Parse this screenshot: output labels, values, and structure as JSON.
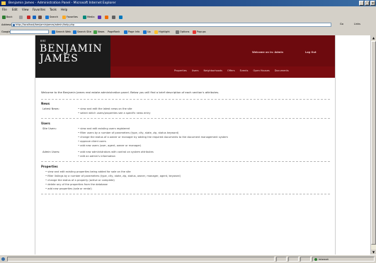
{
  "window": {
    "title": "Benjamin James - Administration Panel - Microsoft Internet Explorer",
    "controls": [
      "_",
      "□",
      "×"
    ]
  },
  "menubar": [
    "File",
    "Edit",
    "View",
    "Favorites",
    "Tools",
    "Help"
  ],
  "toolbar": {
    "back": "Back",
    "forward": "",
    "stop": "",
    "refresh": "",
    "home": "",
    "search": "Search",
    "favorites": "Favorites",
    "media": "Media",
    "history": "",
    "mail": "",
    "print": "",
    "edit": ""
  },
  "addressbar": {
    "label": "Address",
    "url": "http://localhost/benjaminjames/admin/help.php",
    "go": "Go",
    "links": "Links"
  },
  "googlebar": {
    "label": "Google",
    "search_web": "Search Web",
    "search_site": "Search Site",
    "news": "News",
    "pagerank": "PageRank",
    "page_info": "Page Info",
    "up": "Up",
    "highlight": "Highlight",
    "options": "Options",
    "popups": "Popups"
  },
  "site": {
    "logo_small": "BRE",
    "logo_line1": "BENJAMIN",
    "logo_line2": "JAMES",
    "welcome_user": "Welcome on in: Admin",
    "logout": "Log Out",
    "nav": [
      "Properties",
      "Users",
      "Neighborhoods",
      "Offers",
      "Events",
      "Open Houses",
      "Documents"
    ]
  },
  "content": {
    "intro": "Welcome to the Benjamin James real estate administration panel. Below you will find a brief description of each section's attributes.",
    "sections": [
      {
        "title": "News",
        "groups": [
          {
            "label": "Latest News:",
            "bullets": [
              "view and edit the latest news on the site",
              "select which users/properties see a specific news entry"
            ]
          }
        ]
      },
      {
        "title": "Users",
        "groups": [
          {
            "label": "Site Users:",
            "bullets": [
              "view and edit existing users registered",
              "filter users by a number of parameters (type, city, state, zip, status keyword)",
              "change the status of a owner or manager by adding the required documents to the document management system",
              "approve client users",
              "add new users (user, agent, owner or manager)"
            ]
          },
          {
            "label": "Admin Users:",
            "bullets": [
              "add new administrators with control on system attributes",
              "edit an admin's information"
            ]
          }
        ]
      },
      {
        "title": "Properties",
        "groups": [
          {
            "label": "",
            "bullets": [
              "view and edit existing properties being added for sale on the site",
              "filter listings by a number of parameters (type, city, state, zip, status, owner, manager, agent, keyword)",
              "change the status of a property (active or complete)",
              "delete any of the properties from the database",
              "add new properties (sale or rental)"
            ]
          }
        ]
      }
    ]
  },
  "statusbar": {
    "zone": "Internet"
  }
}
